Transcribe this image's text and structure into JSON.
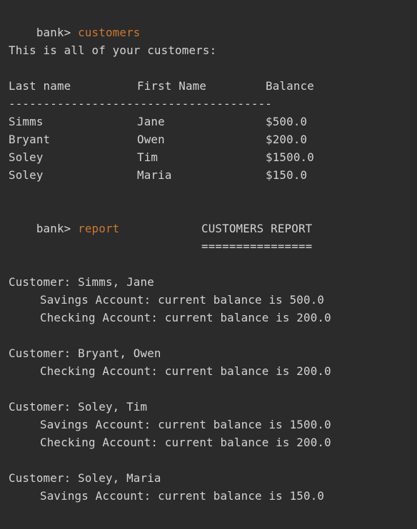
{
  "prompt": "bank>",
  "commands": {
    "customers": "customers",
    "report": "report"
  },
  "intro": "This is all of your customers:",
  "table": {
    "headers": [
      "Last name",
      "First Name",
      "Balance"
    ],
    "divider": "--------------------------------------",
    "rows": [
      [
        "Simms",
        "Jane",
        "$500.0"
      ],
      [
        "Bryant",
        "Owen",
        "$200.0"
      ],
      [
        "Soley",
        "Tim",
        "$1500.0"
      ],
      [
        "Soley",
        "Maria",
        "$150.0"
      ]
    ]
  },
  "report": {
    "title": "CUSTOMERS REPORT",
    "underline": "================",
    "customers": [
      {
        "header": "Customer: Simms, Jane",
        "accounts": [
          "Savings Account: current balance is 500.0",
          "Checking Account: current balance is 200.0"
        ]
      },
      {
        "header": "Customer: Bryant, Owen",
        "accounts": [
          "Checking Account: current balance is 200.0"
        ]
      },
      {
        "header": "Customer: Soley, Tim",
        "accounts": [
          "Savings Account: current balance is 1500.0",
          "Checking Account: current balance is 200.0"
        ]
      },
      {
        "header": "Customer: Soley, Maria",
        "accounts": [
          "Savings Account: current balance is 150.0"
        ]
      }
    ]
  }
}
